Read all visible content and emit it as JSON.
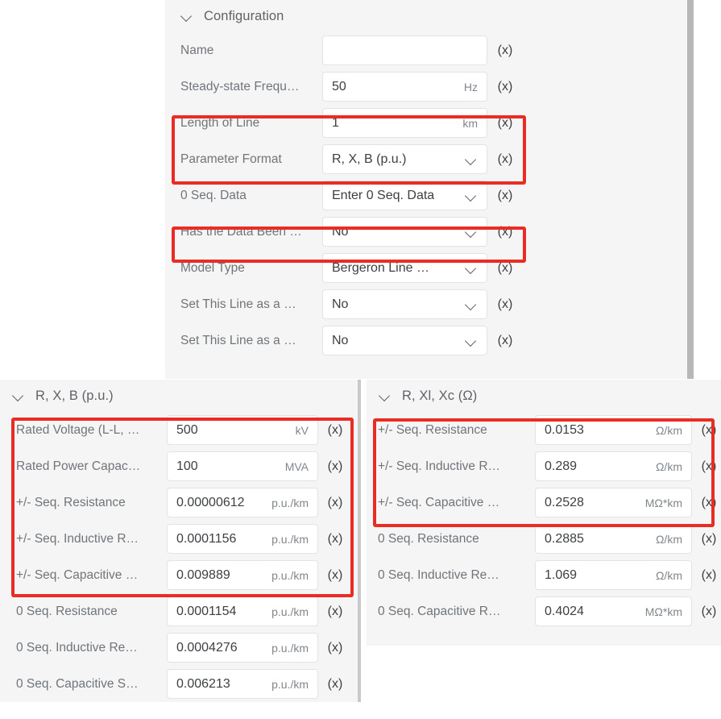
{
  "panels": {
    "configuration": {
      "title": "Configuration",
      "rows": [
        {
          "label": "Name",
          "value": "",
          "unit": "",
          "type": "text"
        },
        {
          "label": "Steady-state Frequ…",
          "value": "50",
          "unit": "Hz",
          "type": "text"
        },
        {
          "label": "Length of Line",
          "value": "1",
          "unit": "km",
          "type": "text"
        },
        {
          "label": "Parameter Format",
          "value": "R, X, B (p.u.)",
          "unit": "",
          "type": "select"
        },
        {
          "label": "0 Seq. Data",
          "value": "Enter 0 Seq. Data",
          "unit": "",
          "type": "select"
        },
        {
          "label": "Has the Data Been …",
          "value": "No",
          "unit": "",
          "type": "select"
        },
        {
          "label": "Model Type",
          "value": "Bergeron Line …",
          "unit": "",
          "type": "select"
        },
        {
          "label": "Set This Line as a …",
          "value": "No",
          "unit": "",
          "type": "select"
        },
        {
          "label": "Set This Line as a …",
          "value": "No",
          "unit": "",
          "type": "select"
        }
      ]
    },
    "rxb_pu": {
      "title": "R, X, B (p.u.)",
      "rows": [
        {
          "label": "Rated Voltage (L-L, …",
          "value": "500",
          "unit": "kV",
          "type": "text"
        },
        {
          "label": "Rated Power Capac…",
          "value": "100",
          "unit": "MVA",
          "type": "text"
        },
        {
          "label": "+/- Seq. Resistance",
          "value": "0.00000612",
          "unit": "p.u./km",
          "type": "text"
        },
        {
          "label": "+/- Seq. Inductive R…",
          "value": "0.0001156",
          "unit": "p.u./km",
          "type": "text"
        },
        {
          "label": "+/- Seq. Capacitive …",
          "value": "0.009889",
          "unit": "p.u./km",
          "type": "text"
        },
        {
          "label": "0 Seq. Resistance",
          "value": "0.0001154",
          "unit": "p.u./km",
          "type": "text"
        },
        {
          "label": "0 Seq. Inductive Re…",
          "value": "0.0004276",
          "unit": "p.u./km",
          "type": "text"
        },
        {
          "label": "0 Seq. Capacitive S…",
          "value": "0.006213",
          "unit": "p.u./km",
          "type": "text"
        }
      ]
    },
    "rxlxc_ohm": {
      "title": "R, Xl, Xc (Ω)",
      "rows": [
        {
          "label": "+/- Seq. Resistance",
          "value": "0.0153",
          "unit": "Ω/km",
          "type": "text"
        },
        {
          "label": "+/- Seq. Inductive R…",
          "value": "0.289",
          "unit": "Ω/km",
          "type": "text"
        },
        {
          "label": "+/- Seq. Capacitive …",
          "value": "0.2528",
          "unit": "MΩ*km",
          "type": "text"
        },
        {
          "label": "0 Seq. Resistance",
          "value": "0.2885",
          "unit": "Ω/km",
          "type": "text"
        },
        {
          "label": "0 Seq. Inductive Re…",
          "value": "1.069",
          "unit": "Ω/km",
          "type": "text"
        },
        {
          "label": "0 Seq. Capacitive R…",
          "value": "0.4024",
          "unit": "MΩ*km",
          "type": "text"
        }
      ]
    }
  },
  "buttons": {
    "expression_label": "(x)"
  },
  "colors": {
    "highlight": "#ea2d24",
    "panel_bg": "#f5f5f5",
    "field_bg": "#ffffff",
    "label_text": "#70757a",
    "value_text": "#3c4043",
    "unit_text": "#80868b"
  }
}
